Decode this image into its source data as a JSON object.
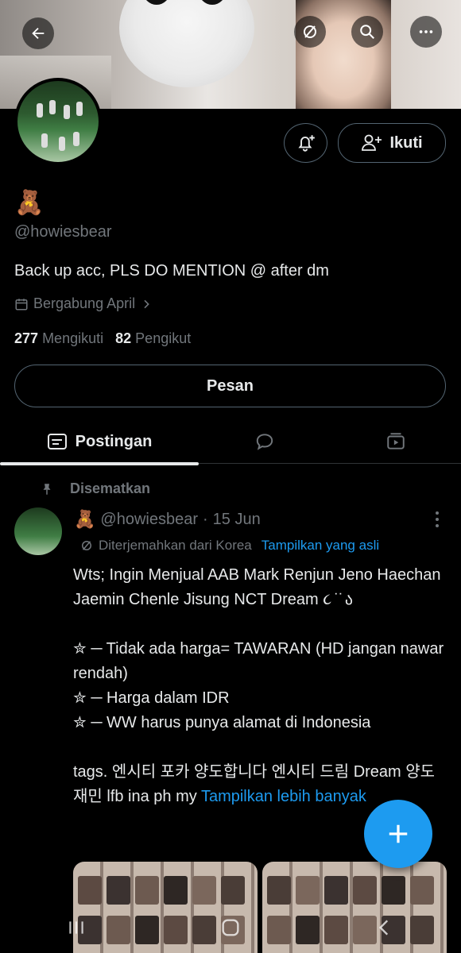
{
  "profile": {
    "emoji": "🧸",
    "handle": "@howiesbear",
    "bio": "Back up acc, PLS DO MENTION @ after dm",
    "joined": "Bergabung April",
    "following_count": "277",
    "following_label": "Mengikuti",
    "followers_count": "82",
    "followers_label": "Pengikut"
  },
  "actions": {
    "follow_label": "Ikuti",
    "message_label": "Pesan"
  },
  "tabs": [
    {
      "label": "Postingan",
      "icon": "posts-icon",
      "active": true
    },
    {
      "label": "",
      "icon": "replies-icon",
      "active": false
    },
    {
      "label": "",
      "icon": "media-icon",
      "active": false
    }
  ],
  "post": {
    "pinned_label": "Disematkan",
    "author_emoji": "🧸",
    "author_handle": "@howiesbear",
    "separator": "·",
    "date": "15 Jun",
    "translated_label": "Diterjemahkan dari Korea",
    "show_original": "Tampilkan yang asli",
    "text_line_1": "Wts; Ingin Menjual AAB Mark Renjun Jeno Haechan Jaemin Chenle Jisung NCT Dream ૮ ̇ ̇ ა",
    "text_line_2": "✮ ─ Tidak ada harga= TAWARAN (HD jangan nawar rendah)\n✮ ─ Harga dalam IDR\n✮ ─ WW harus punya alamat di Indonesia",
    "text_line_3": "tags. 엔시티 포카 양도합니다 엔시티 드림 Dream 양도 재민 lfb ina ph my ",
    "show_more": "Tampilkan lebih banyak"
  },
  "colors": {
    "accent": "#1d9bf0",
    "background": "#000000",
    "muted": "#71767b",
    "text": "#e7e9ea"
  }
}
